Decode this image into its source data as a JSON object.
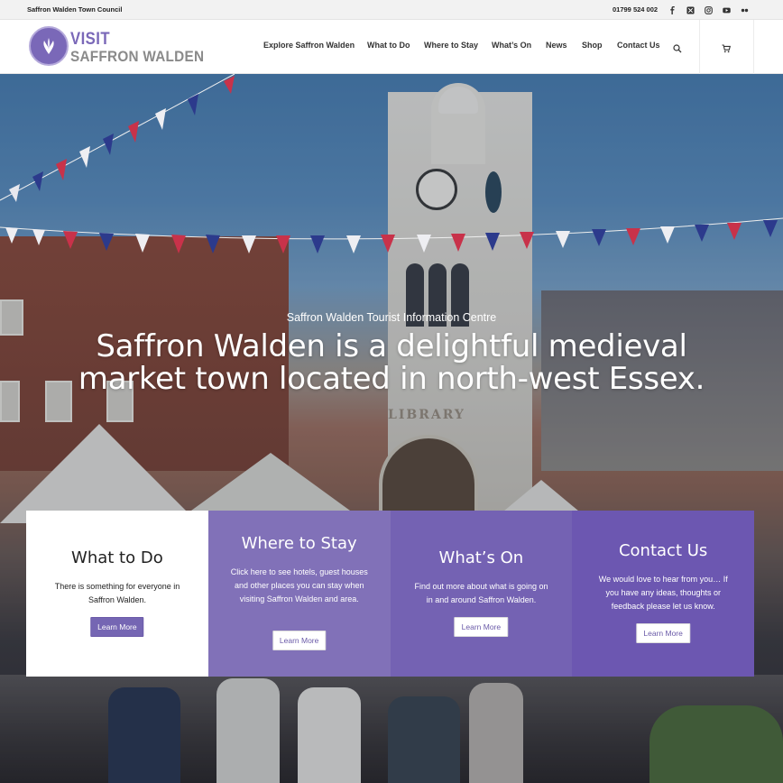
{
  "topbar": {
    "council": "Saffron Walden Town Council",
    "phone": "01799 524 002",
    "social": [
      "facebook-icon",
      "x-icon",
      "instagram-icon",
      "youtube-icon",
      "flickr-icon"
    ]
  },
  "header": {
    "logo_line1": "VISIT",
    "logo_line2": "SAFFRON WALDEN",
    "nav": [
      {
        "label": "Explore Saffron Walden"
      },
      {
        "label": "What to Do"
      },
      {
        "label": "Where to Stay"
      },
      {
        "label": "What’s On"
      },
      {
        "label": "News"
      },
      {
        "label": "Shop"
      },
      {
        "label": "Contact Us"
      }
    ],
    "search_icon": "search-icon",
    "cart_icon": "cart-icon"
  },
  "hero": {
    "subtitle": "Saffron Walden Tourist Information Centre",
    "title": "Saffron Walden is a delightful medieval market town located in north-west Essex.",
    "image_text": "LIBRARY"
  },
  "boxes": [
    {
      "title": "What to Do",
      "text": "There is something for everyone in Saffron Walden.",
      "button": "Learn More"
    },
    {
      "title": "Where to Stay",
      "text": "Click here to see hotels, guest houses and other places you can stay when visiting Saffron Walden and area.",
      "button": "Learn More"
    },
    {
      "title": "What’s On",
      "text": "Find out more about what is going on in and around Saffron Walden.",
      "button": "Learn More"
    },
    {
      "title": "Contact Us",
      "text": "We would love to hear from you… If you have any ideas, thoughts or feedback please let us know.",
      "button": "Learn More"
    }
  ],
  "colors": {
    "brand_purple": "#7a68b8",
    "box2": "#8171b8",
    "box3": "#7462b3",
    "box4": "#6c57b1"
  }
}
